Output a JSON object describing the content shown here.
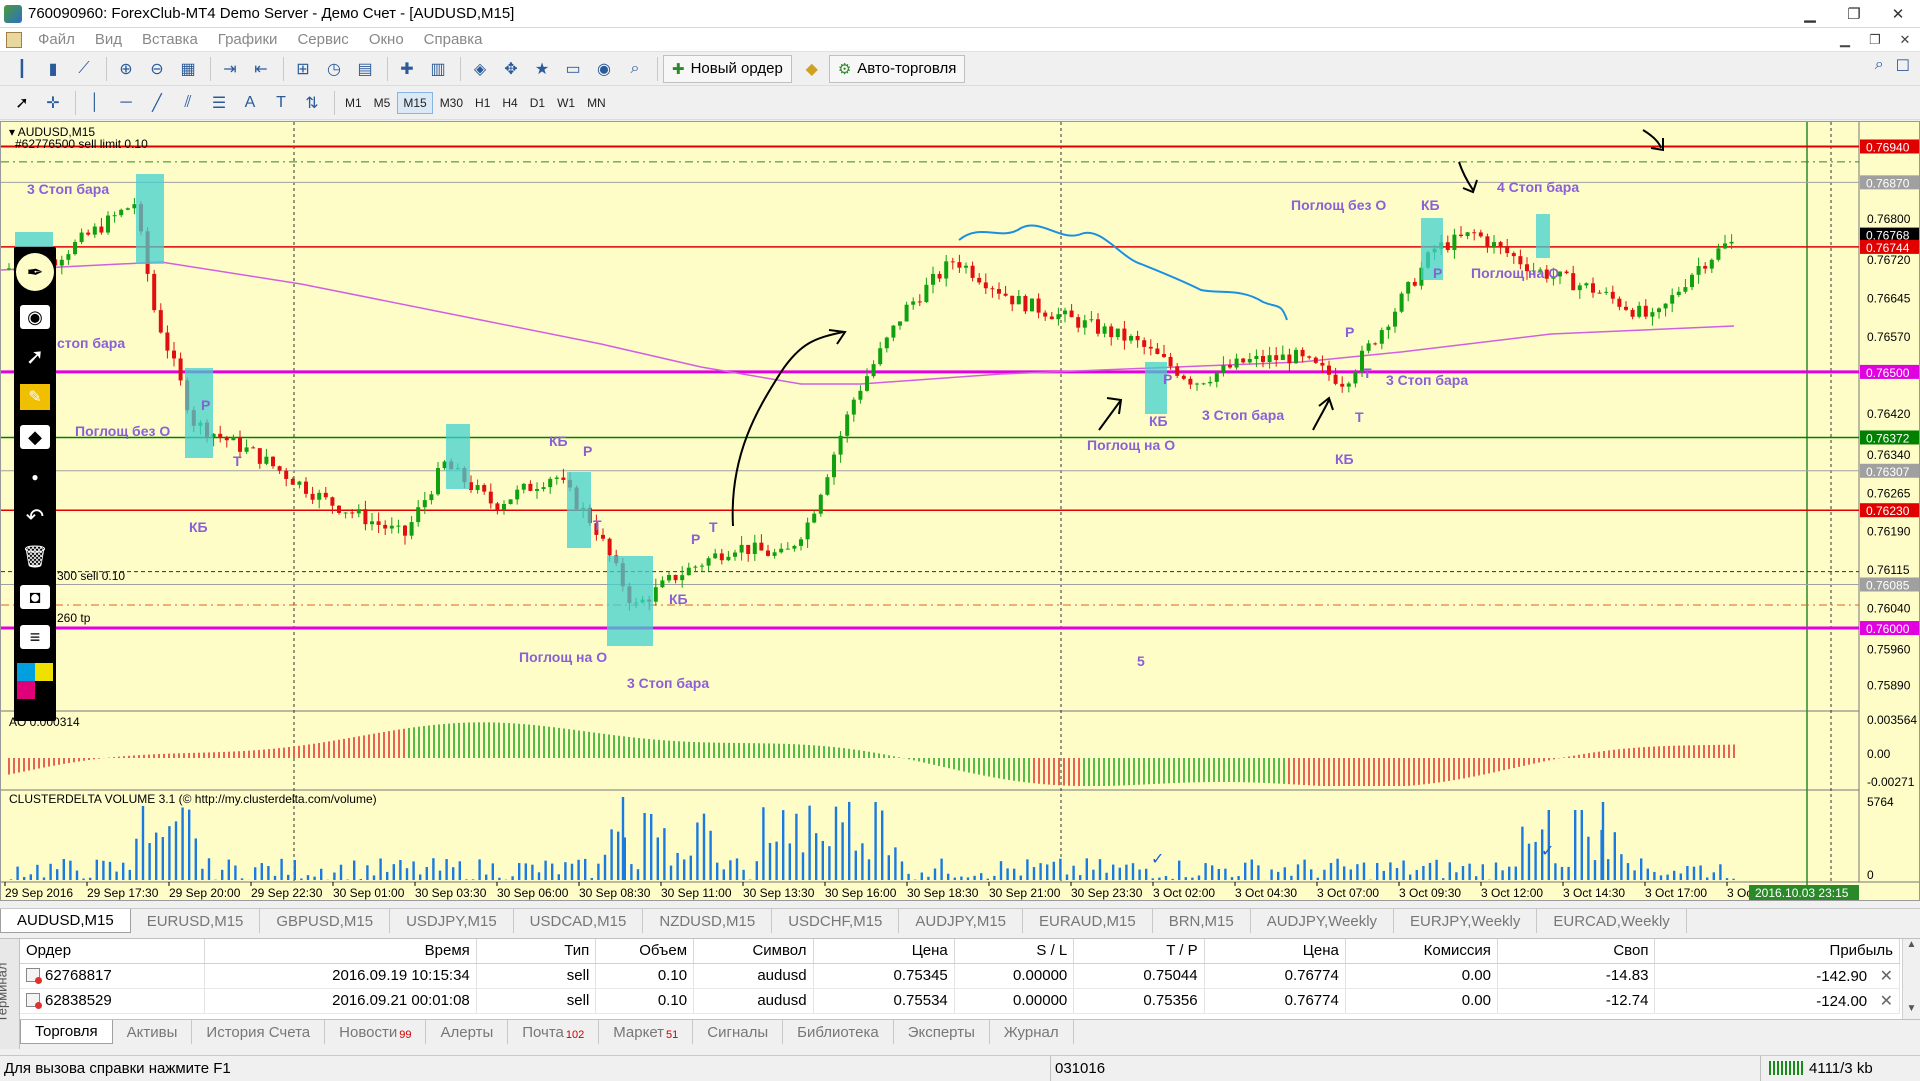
{
  "window": {
    "title": "760090960: ForexClub-MT4 Demo Server - Демо Счет - [AUDUSD,M15]"
  },
  "menu": [
    "Файл",
    "Вид",
    "Вставка",
    "Графики",
    "Сервис",
    "Окно",
    "Справка"
  ],
  "toolbar": {
    "new_order_label": "Новый ордер",
    "autotrading_label": "Авто-торговля"
  },
  "timeframes": [
    "M1",
    "M5",
    "M15",
    "M30",
    "H1",
    "H4",
    "D1",
    "W1",
    "MN"
  ],
  "active_timeframe": "M15",
  "chart": {
    "symbol_label": "AUDUSD,M15",
    "sell_limit_label": "#62776500 sell limit 0.10",
    "sell_label": "300 sell 0.10",
    "tp_label": "260 tp",
    "ao_label": "AO 0.000314",
    "cluster_label": "CLUSTERDELTA VOLUME 3.1 (© http://my.clusterdelta.com/volume)",
    "price_axis": [
      "0.76800",
      "0.76720",
      "0.76645",
      "0.76570",
      "0.76420",
      "0.76340",
      "0.76265",
      "0.76190",
      "0.76115",
      "0.76040",
      "0.75960",
      "0.75890"
    ],
    "price_tags": [
      {
        "value": "0.76940",
        "color": "#e00000"
      },
      {
        "value": "0.76870",
        "color": "#a0a0a0"
      },
      {
        "value": "0.76768",
        "color": "#000000"
      },
      {
        "value": "0.76744",
        "color": "#e00000"
      },
      {
        "value": "0.76500",
        "color": "#e000e0"
      },
      {
        "value": "0.76372",
        "color": "#008000"
      },
      {
        "value": "0.76307",
        "color": "#a0a0a0"
      },
      {
        "value": "0.76230",
        "color": "#e00000"
      },
      {
        "value": "0.76085",
        "color": "#a0a0a0"
      },
      {
        "value": "0.76000",
        "color": "#e000e0"
      }
    ],
    "ao_axis": [
      "0.003564",
      "0.00",
      "-0.00271"
    ],
    "vol_axis": [
      "5764",
      "0"
    ],
    "time_axis": [
      "29 Sep 2016",
      "29 Sep 17:30",
      "29 Sep 20:00",
      "29 Sep 22:30",
      "30 Sep 01:00",
      "30 Sep 03:30",
      "30 Sep 06:00",
      "30 Sep 08:30",
      "30 Sep 11:00",
      "30 Sep 13:30",
      "30 Sep 16:00",
      "30 Sep 18:30",
      "30 Sep 21:00",
      "30 Sep 23:30",
      "3 Oct 02:00",
      "3 Oct 04:30",
      "3 Oct 07:00",
      "3 Oct 09:30",
      "3 Oct 12:00",
      "3 Oct 14:30",
      "3 Oct 17:00",
      "3 Oct 19:30"
    ],
    "time_cursor": "2016.10.03 23:15",
    "annotations": [
      "3 Стоп бара",
      "стоп бара",
      "Поглощ без О",
      "КБ",
      "Т",
      "Р",
      "КБ",
      "Р",
      "Т",
      "Поглощ на О",
      "3 Стоп бара",
      "КБ",
      "Р",
      "Т",
      "Поглощ на О",
      "КБ",
      "Р",
      "3 Стоп бара",
      "Т",
      "КБ",
      "Т",
      "Р",
      "3 Стоп бара",
      "Поглощ без О",
      "КБ",
      "Р",
      "4 Стоп бара",
      "Поглощ на О",
      "5"
    ]
  },
  "symbol_tabs": [
    "AUDUSD,M15",
    "EURUSD,M15",
    "GBPUSD,M15",
    "USDJPY,M15",
    "USDCAD,M15",
    "NZDUSD,M15",
    "USDCHF,M15",
    "AUDJPY,M15",
    "EURAUD,M15",
    "BRN,M15",
    "AUDJPY,Weekly",
    "EURJPY,Weekly",
    "EURCAD,Weekly"
  ],
  "terminal": {
    "side_label": "Терминал",
    "columns": [
      "Ордер",
      "Время",
      "Тип",
      "Объем",
      "Символ",
      "Цена",
      "S / L",
      "T / P",
      "Цена",
      "Комиссия",
      "Своп",
      "Прибыль"
    ],
    "rows": [
      [
        "62768817",
        "2016.09.19 10:15:34",
        "sell",
        "0.10",
        "audusd",
        "0.75345",
        "0.00000",
        "0.75044",
        "0.76774",
        "0.00",
        "-14.83",
        "-142.90"
      ],
      [
        "62838529",
        "2016.09.21 00:01:08",
        "sell",
        "0.10",
        "audusd",
        "0.75534",
        "0.00000",
        "0.75356",
        "0.76774",
        "0.00",
        "-12.74",
        "-124.00"
      ]
    ],
    "tabs": [
      {
        "label": "Торговля",
        "badge": ""
      },
      {
        "label": "Активы",
        "badge": ""
      },
      {
        "label": "История Счета",
        "badge": ""
      },
      {
        "label": "Новости",
        "badge": "99"
      },
      {
        "label": "Алерты",
        "badge": ""
      },
      {
        "label": "Почта",
        "badge": "102"
      },
      {
        "label": "Маркет",
        "badge": "51"
      },
      {
        "label": "Сигналы",
        "badge": ""
      },
      {
        "label": "Библиотека",
        "badge": ""
      },
      {
        "label": "Эксперты",
        "badge": ""
      },
      {
        "label": "Журнал",
        "badge": ""
      }
    ]
  },
  "status": {
    "help": "Для вызова справки нажмите F1",
    "profile": "031016",
    "traffic": "4111/3 kb"
  }
}
